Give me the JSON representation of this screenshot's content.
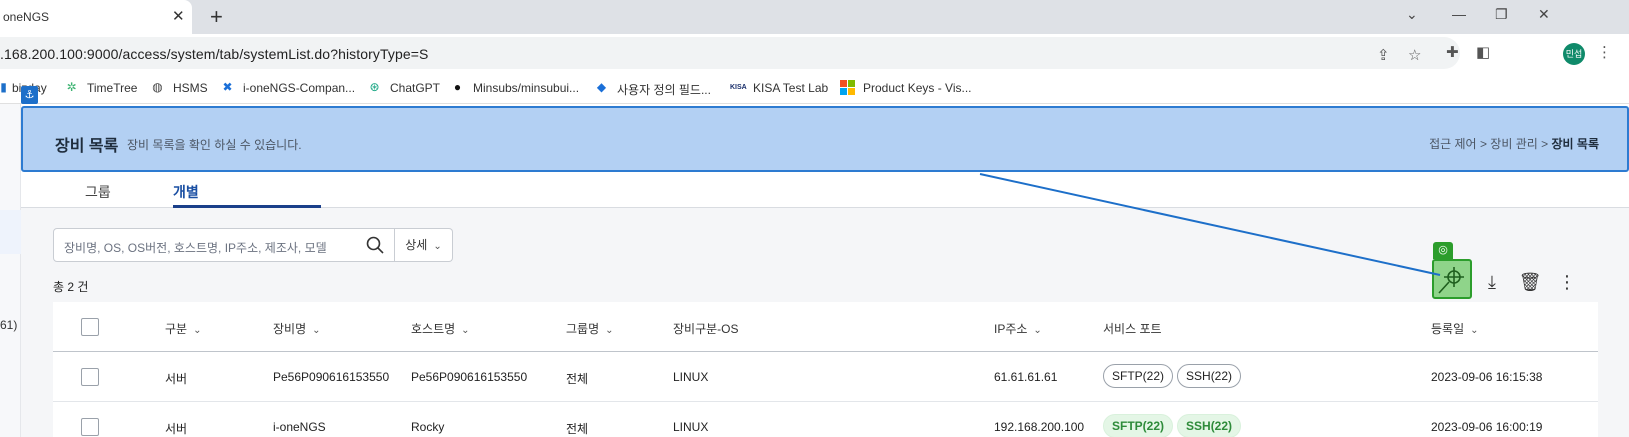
{
  "browser": {
    "tab_title": "oneNGS",
    "url": ".168.200.100:9000/access/system/tab/systemList.do?historyType=S",
    "avatar_text": "민섭"
  },
  "bookmarks": [
    {
      "label": "bizday",
      "icon": "bookmark-icon"
    },
    {
      "label": "TimeTree",
      "icon": "timetree-icon"
    },
    {
      "label": "HSMS",
      "icon": "globe-icon"
    },
    {
      "label": "i-oneNGS-Compan...",
      "icon": "blue-x-icon"
    },
    {
      "label": "ChatGPT",
      "icon": "chatgpt-icon"
    },
    {
      "label": "Minsubs/minsubui...",
      "icon": "github-icon"
    },
    {
      "label": "사용자 정의 필드...",
      "icon": "diamond-icon"
    },
    {
      "label": "KISA Test Lab",
      "icon": "kisa-icon"
    },
    {
      "label": "Product Keys - Vis...",
      "icon": "microsoft-icon"
    }
  ],
  "header": {
    "title": "장비 목록",
    "subtitle": "장비 목록을 확인 하실 수 있습니다.",
    "breadcrumb": [
      "접근 제어",
      "장비 관리",
      "장비 목록"
    ],
    "separator": ">"
  },
  "tabs": [
    "그룹",
    "개별"
  ],
  "search": {
    "placeholder": "장비명, OS, OS버전, 호스트명, IP주소, 제조사, 모델",
    "detail_label": "상세"
  },
  "total_label": "총 2 건",
  "left_fragment": "61)",
  "table": {
    "columns": [
      "구분",
      "장비명",
      "호스트명",
      "그룹명",
      "장비구분-OS",
      "IP주소",
      "서비스 포트",
      "등록일"
    ],
    "rows": [
      {
        "type": "서버",
        "name": "Pe56P090616153550",
        "host": "Pe56P090616153550",
        "group": "전체",
        "os": "LINUX",
        "ip": "61.61.61.61",
        "ports": [
          "SFTP(22)",
          "SSH(22)"
        ],
        "port_style": "outline",
        "date": "2023-09-06 16:15:38"
      },
      {
        "type": "서버",
        "name": "i-oneNGS",
        "host": "Rocky",
        "group": "전체",
        "os": "LINUX",
        "ip": "192.168.200.100",
        "ports": [
          "SFTP(22)",
          "SSH(22)"
        ],
        "port_style": "green",
        "date": "2023-09-06 16:00:19"
      }
    ]
  },
  "colors": {
    "header_bg": "#b3d0f3",
    "header_border": "#2d7bd1",
    "tab_active": "#1a4fa3",
    "target_green": "#8fd48a",
    "pill_green": "#2e8b3a"
  }
}
